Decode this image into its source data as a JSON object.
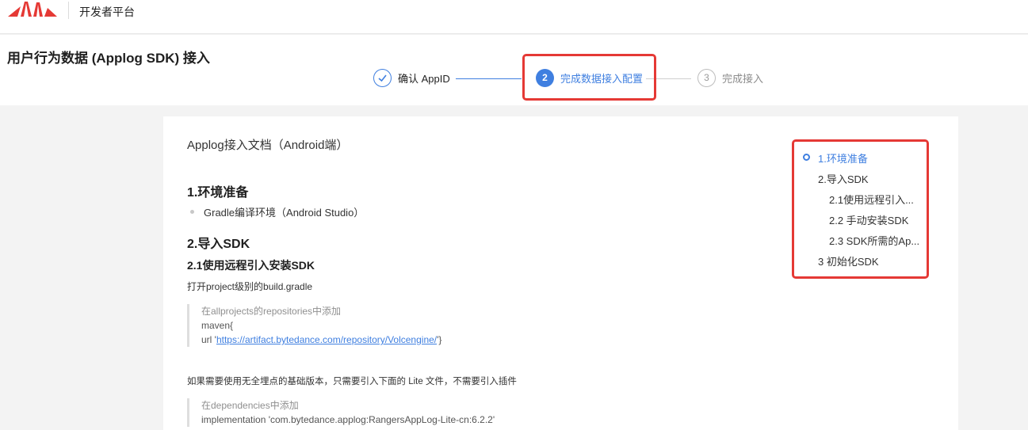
{
  "topbar": {
    "platform_name": "开发者平台",
    "brand_color": "#e53935"
  },
  "header": {
    "page_title": "用户行为数据 (Applog SDK) 接入",
    "steps": [
      {
        "label": "确认 AppID",
        "state": "done"
      },
      {
        "number": "2",
        "label": "完成数据接入配置",
        "state": "active"
      },
      {
        "number": "3",
        "label": "完成接入",
        "state": "pending"
      }
    ],
    "accent_color": "#3f7fe0"
  },
  "doc": {
    "title": "Applog接入文档（Android端）",
    "section1": {
      "heading": "1.环境准备",
      "bullet": "Gradle编译环境（Android Studio）"
    },
    "section2": {
      "heading": "2.导入SDK",
      "sub1": {
        "heading": "2.1使用远程引入安装SDK",
        "instruction": "打开project级别的build.gradle",
        "code": {
          "comment": "在allprojects的repositories中添加",
          "line1": "maven{",
          "line2_prefix": "url '",
          "line2_link": "https://artifact.bytedance.com/repository/Volcengine/",
          "line2_suffix": "'}"
        }
      },
      "lite_note": "如果需要使用无全埋点的基础版本，只需要引入下面的 Lite 文件，不需要引入插件",
      "code2": {
        "comment": "在dependencies中添加",
        "line1": "implementation 'com.bytedance.applog:RangersAppLog-Lite-cn:6.2.2'"
      }
    }
  },
  "toc": {
    "items": [
      {
        "label": "1.环境准备",
        "active": true
      },
      {
        "label": "2.导入SDK"
      },
      {
        "label": "2.1使用远程引入..."
      },
      {
        "label": "2.2 手动安装SDK"
      },
      {
        "label": "2.3 SDK所需的Ap..."
      },
      {
        "label": "3 初始化SDK"
      }
    ]
  },
  "highlight_color": "#e53935"
}
